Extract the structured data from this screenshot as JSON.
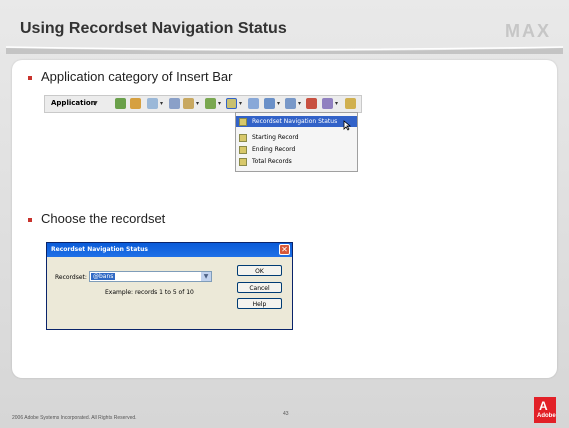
{
  "slide": {
    "title": "Using Recordset Navigation Status",
    "logo_text": "MAX",
    "bullets": [
      "Application category of Insert Bar",
      "Choose the recordset"
    ]
  },
  "insert_bar": {
    "category_label": "Application",
    "icons": [
      "recordset-icon",
      "dynamic-data-icon",
      "repeated-region-icon",
      "show-region-icon",
      "navigation-bar-icon",
      "navigation-status-icon",
      "master-detail-icon",
      "insert-record-icon",
      "update-record-icon",
      "delete-record-icon",
      "user-auth-icon",
      "xslt-icon"
    ]
  },
  "menu": {
    "items": [
      {
        "label": "Recordset Navigation Status",
        "selected": true
      },
      {
        "label": "Starting Record",
        "selected": false
      },
      {
        "label": "Ending Record",
        "selected": false
      },
      {
        "label": "Total Records",
        "selected": false
      }
    ]
  },
  "dialog": {
    "title": "Recordset Navigation Status",
    "recordset_label": "Recordset:",
    "recordset_value": "@bans",
    "example_text": "Example: records 1 to 5 of 10",
    "buttons": {
      "ok": "OK",
      "cancel": "Cancel",
      "help": "Help"
    }
  },
  "footer": {
    "copyright": "2006 Adobe Systems Incorporated.  All Rights Reserved.",
    "page_number": "43",
    "adobe_text": "Adobe"
  },
  "colors": {
    "bullet": "#c8332d",
    "adobe_red": "#e22027",
    "dialog_title": "#0a5bd8",
    "menu_selected": "#3262c8"
  }
}
